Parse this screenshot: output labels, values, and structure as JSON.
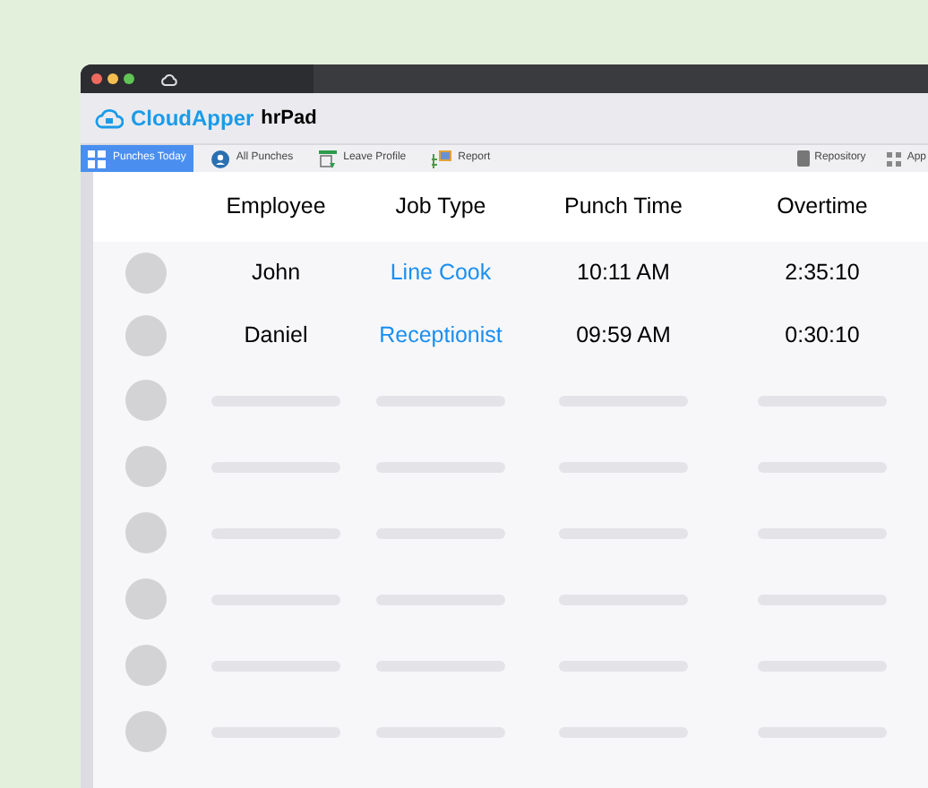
{
  "app": {
    "brand": "CloudApper",
    "product": "hrPad"
  },
  "tabs": [
    {
      "label": "Punches Today",
      "selected": true,
      "kind": "grid"
    },
    {
      "label": "All Punches",
      "selected": false,
      "kind": "user"
    },
    {
      "label": "Leave Profile",
      "selected": false,
      "kind": "calendar"
    },
    {
      "label": "Report",
      "selected": false,
      "kind": "chart"
    }
  ],
  "right_tabs": [
    {
      "label": "Repository",
      "kind": "doc"
    },
    {
      "label": "App",
      "kind": "apps"
    }
  ],
  "table": {
    "columns": [
      "Employee",
      "Job Type",
      "Punch Time",
      "Overtime"
    ],
    "rows": [
      {
        "kind": "employee",
        "employee": "John",
        "job_type": "Line Cook",
        "punch_time": "10:11 AM",
        "overtime": "2:35:10"
      },
      {
        "kind": "employee",
        "employee": "Daniel",
        "job_type": "Receptionist",
        "punch_time": "09:59 AM",
        "overtime": "0:30:10"
      },
      {
        "kind": "placeholder"
      },
      {
        "kind": "placeholder"
      },
      {
        "kind": "placeholder"
      },
      {
        "kind": "placeholder"
      },
      {
        "kind": "placeholder"
      },
      {
        "kind": "placeholder"
      }
    ]
  }
}
